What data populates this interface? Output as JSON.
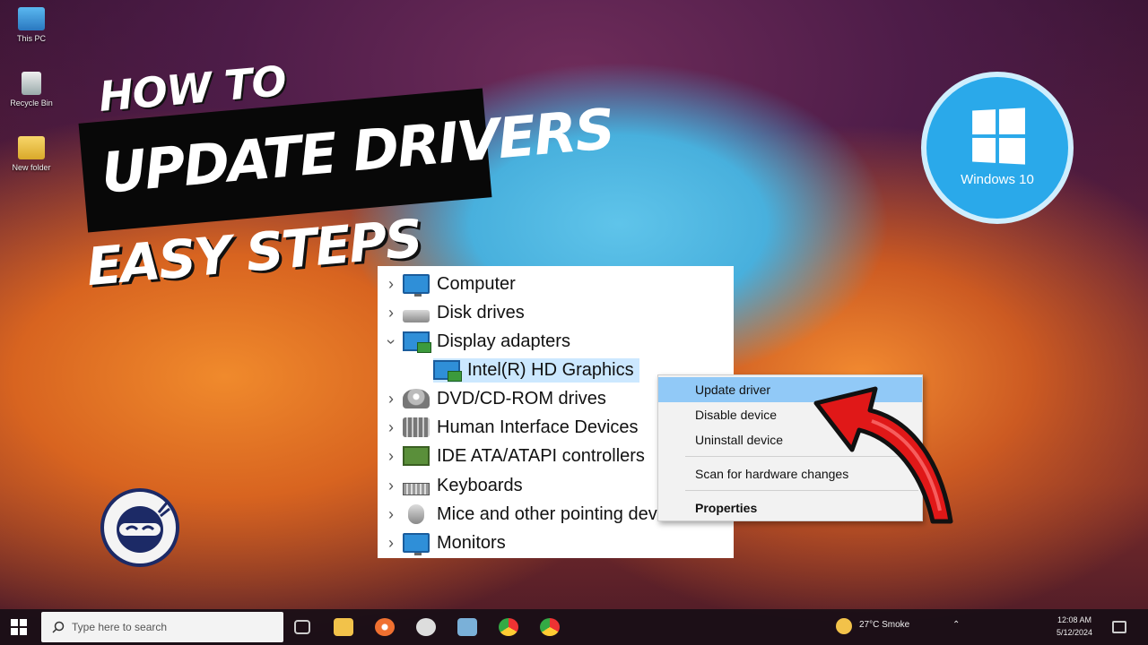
{
  "desktop": {
    "icons": [
      {
        "label": "This PC"
      },
      {
        "label": "Recycle Bin"
      },
      {
        "label": "New folder"
      }
    ]
  },
  "title": {
    "line1": "HOW TO",
    "line2": "UPDATE DRIVERS",
    "line3_word1": "EASY",
    "line3_word2": "STEPS"
  },
  "windows_badge": {
    "label": "Windows 10",
    "color": "#2aa9ea"
  },
  "device_manager": {
    "items": [
      {
        "label": "Computer",
        "icon": "monitor-icon",
        "expanded": false
      },
      {
        "label": "Disk drives",
        "icon": "disk-drive-icon",
        "expanded": false
      },
      {
        "label": "Display adapters",
        "icon": "display-adapter-icon",
        "expanded": true
      },
      {
        "label": "Intel(R) HD Graphics",
        "icon": "display-adapter-icon",
        "child": true,
        "selected": true
      },
      {
        "label": "DVD/CD-ROM drives",
        "icon": "dvd-drive-icon",
        "expanded": false
      },
      {
        "label": "Human Interface Devices",
        "icon": "hid-icon",
        "expanded": false
      },
      {
        "label": "IDE ATA/ATAPI controllers",
        "icon": "ide-controller-icon",
        "expanded": false
      },
      {
        "label": "Keyboards",
        "icon": "keyboard-icon",
        "expanded": false
      },
      {
        "label": "Mice and other pointing devices",
        "icon": "mouse-icon",
        "expanded": false
      },
      {
        "label": "Monitors",
        "icon": "monitor-icon",
        "expanded": false
      }
    ]
  },
  "context_menu": {
    "items": [
      {
        "label": "Update driver",
        "highlighted": true
      },
      {
        "label": "Disable device"
      },
      {
        "label": "Uninstall device"
      },
      {
        "label": "Scan for hardware changes"
      },
      {
        "label": "Properties",
        "bold": true
      }
    ]
  },
  "taskbar": {
    "search_placeholder": "Type here to search",
    "weather": "27°C Smoke",
    "time": "12:08 AM",
    "date": "5/12/2024"
  },
  "colors": {
    "arrow": "#e01818",
    "highlight": "#91c9f7",
    "selection": "#cce8ff"
  }
}
